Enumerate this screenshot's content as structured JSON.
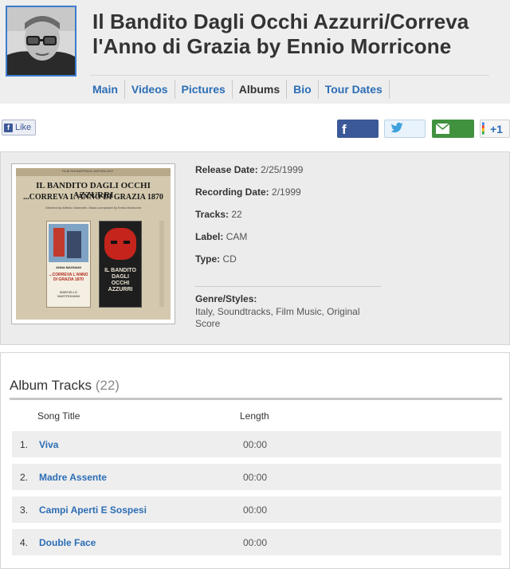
{
  "artist_photo_alt": "Ennio Morricone",
  "page_title": "Il Bandito Dagli Occhi Azzurri/Correva l'Anno di Grazia by Ennio Morricone",
  "nav": [
    {
      "label": "Main",
      "active": false
    },
    {
      "label": "Videos",
      "active": false
    },
    {
      "label": "Pictures",
      "active": false
    },
    {
      "label": "Albums",
      "active": true
    },
    {
      "label": "Bio",
      "active": false
    },
    {
      "label": "Tour Dates",
      "active": false
    }
  ],
  "social": {
    "like_label": "Like",
    "plus_label": "+1"
  },
  "cover": {
    "header_text": "Film Soundtrack Anthology",
    "title_line1": "IL BANDITO DAGLI OCCHI AZZURRI",
    "title_line2": "...CORREVA L'ANNO DI GRAZIA 1870",
    "credits": "Directed by Alfredo Giannetti • Music composed by Ennio Morricone",
    "left_poster_top": "ANNA MAGNANI",
    "left_poster_title": "...CORREVA L'ANNO DI GRAZIA 1870",
    "left_poster_bottom": "MARCELLO MASTROIANNI",
    "right_poster_title": "IL BANDITO DAGLI OCCHI AZZURRI"
  },
  "album": {
    "release_date_label": "Release Date:",
    "release_date": "2/25/1999",
    "recording_date_label": "Recording Date:",
    "recording_date": "2/1999",
    "tracks_label": "Tracks:",
    "tracks": "22",
    "label_label": "Label:",
    "label": "CAM",
    "type_label": "Type:",
    "type": "CD",
    "genre_label": "Genre/Styles:",
    "genre": "Italy, Soundtracks, Film Music, Original Score"
  },
  "tracks_section": {
    "heading": "Album Tracks",
    "count": "(22)",
    "col_title": "Song Title",
    "col_length": "Length",
    "items": [
      {
        "num": "1.",
        "title": "Viva",
        "length": "00:00"
      },
      {
        "num": "2.",
        "title": "Madre Assente",
        "length": "00:00"
      },
      {
        "num": "3.",
        "title": "Campi Aperti E Sospesi",
        "length": "00:00"
      },
      {
        "num": "4.",
        "title": "Double Face",
        "length": "00:00"
      }
    ]
  },
  "colors": {
    "link": "#2c6db5",
    "facebook": "#3b5998",
    "email": "#41923f",
    "photo_border": "#3d7bd0"
  }
}
